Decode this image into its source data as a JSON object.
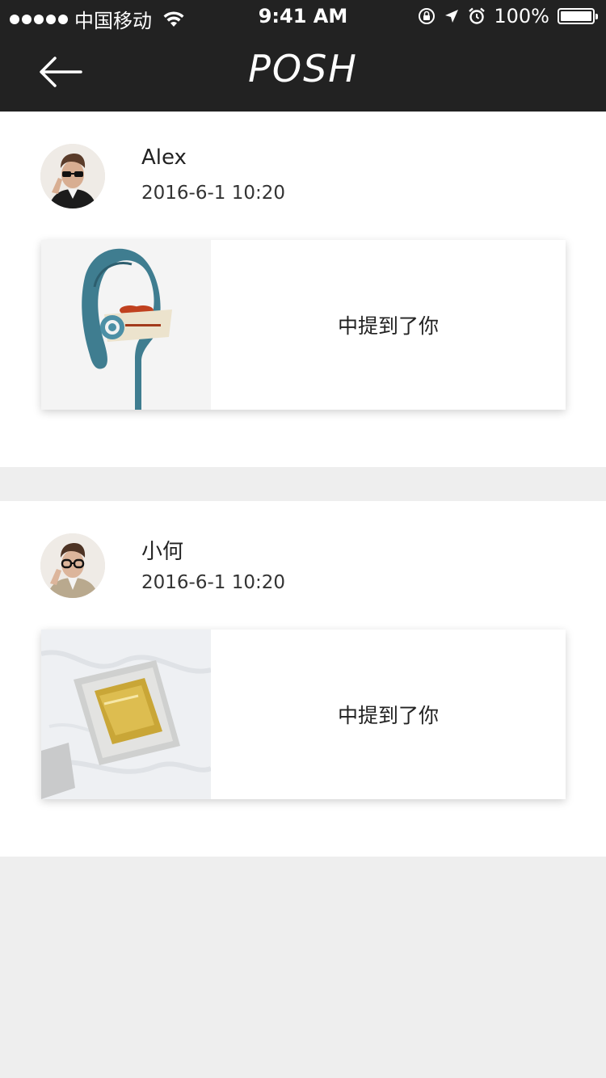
{
  "status_bar": {
    "carrier": "中国移动",
    "time": "9:41 AM",
    "battery": "100%"
  },
  "nav": {
    "title": "POSH",
    "back_icon": "arrow-left-icon"
  },
  "colors": {
    "nav_bg": "#222222",
    "page_bg": "#eeeeee",
    "card_bg": "#ffffff"
  },
  "notifications": [
    {
      "user": "Alex",
      "time": "2016-6-1 10:20",
      "message": "中提到了你",
      "thumb": "earphone-image"
    },
    {
      "user": "小何",
      "time": "2016-6-1 10:20",
      "message": "中提到了你",
      "thumb": "gold-package-image"
    }
  ]
}
